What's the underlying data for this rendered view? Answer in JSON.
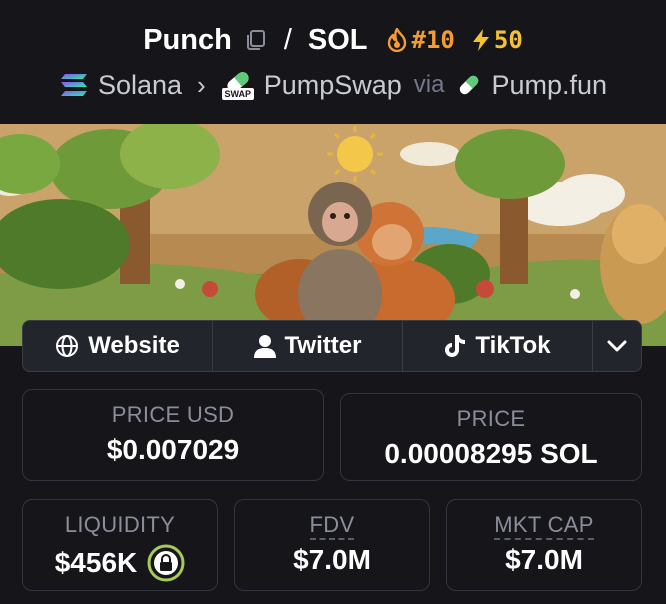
{
  "header": {
    "token_name": "Punch",
    "separator": "/",
    "quote_token": "SOL",
    "rank": "#10",
    "boosts": "50",
    "chain": "Solana",
    "dex": "PumpSwap",
    "dex_badge": "SWAP",
    "via": "via",
    "launchpad": "Pump.fun",
    "icons": [
      "copy-icon",
      "fire-icon",
      "lightning-icon",
      "solana-icon",
      "chevron-right-icon",
      "pumpswap-icon",
      "pill-icon"
    ]
  },
  "links": [
    {
      "label": "Website",
      "icon": "globe-icon"
    },
    {
      "label": "Twitter",
      "icon": "user-icon"
    },
    {
      "label": "TikTok",
      "icon": "tiktok-icon"
    },
    {
      "label": "",
      "icon": "chevron-down-icon"
    }
  ],
  "stats": {
    "price_usd": {
      "label": "PRICE USD",
      "value": "$0.007029"
    },
    "price": {
      "label": "PRICE",
      "value": "0.00008295 SOL"
    },
    "liquidity": {
      "label": "LIQUIDITY",
      "value": "$456K",
      "icon": "lock-icon"
    },
    "fdv": {
      "label": "FDV",
      "value": "$7.0M"
    },
    "mkt_cap": {
      "label": "MKT CAP",
      "value": "$7.0M"
    }
  },
  "colors": {
    "background": "#16161a",
    "card_border": "#33353f",
    "rank": "#f39c34",
    "boost": "#f2c230",
    "lock_ring": "#a7c957"
  }
}
